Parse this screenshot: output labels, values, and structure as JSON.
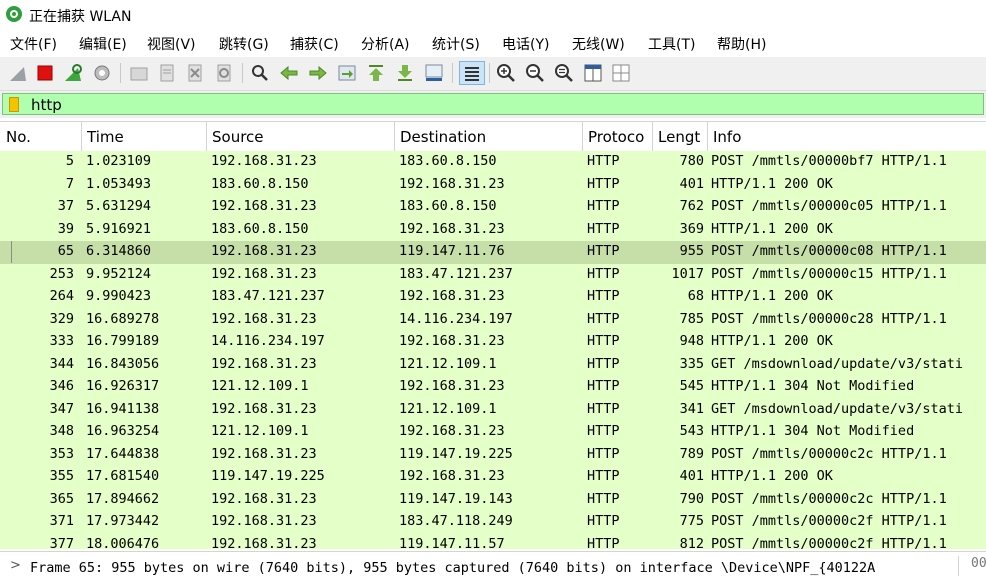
{
  "window": {
    "title": "正在捕获 WLAN"
  },
  "menu": [
    "文件(F)",
    "编辑(E)",
    "视图(V)",
    "跳转(G)",
    "捕获(C)",
    "分析(A)",
    "统计(S)",
    "电话(Y)",
    "无线(W)",
    "工具(T)",
    "帮助(H)"
  ],
  "toolbar": {
    "icons": [
      "shark-fin-start-icon",
      "stop-capture-icon",
      "restart-capture-icon",
      "capture-options-icon",
      "open-file-icon",
      "save-file-icon",
      "close-file-icon",
      "reload-file-icon",
      "find-packet-icon",
      "go-back-icon",
      "go-forward-icon",
      "go-to-packet-icon",
      "go-first-icon",
      "go-last-icon",
      "auto-scroll-icon",
      "colorize-icon",
      "zoom-in-icon",
      "zoom-out-icon",
      "normal-size-icon",
      "resize-columns-icon",
      "layout-icon"
    ]
  },
  "filter": {
    "value": "http"
  },
  "columns": [
    "No.",
    "Time",
    "Source",
    "Destination",
    "Protoco",
    "Lengt",
    "Info"
  ],
  "rows": [
    {
      "no": "5",
      "time": "1.023109",
      "src": "192.168.31.23",
      "dst": "183.60.8.150",
      "proto": "HTTP",
      "len": "780",
      "info": "POST /mmtls/00000bf7 HTTP/1.1"
    },
    {
      "no": "7",
      "time": "1.053493",
      "src": "183.60.8.150",
      "dst": "192.168.31.23",
      "proto": "HTTP",
      "len": "401",
      "info": "HTTP/1.1 200 OK"
    },
    {
      "no": "37",
      "time": "5.631294",
      "src": "192.168.31.23",
      "dst": "183.60.8.150",
      "proto": "HTTP",
      "len": "762",
      "info": "POST /mmtls/00000c05 HTTP/1.1"
    },
    {
      "no": "39",
      "time": "5.916921",
      "src": "183.60.8.150",
      "dst": "192.168.31.23",
      "proto": "HTTP",
      "len": "369",
      "info": "HTTP/1.1 200 OK"
    },
    {
      "no": "65",
      "time": "6.314860",
      "src": "192.168.31.23",
      "dst": "119.147.11.76",
      "proto": "HTTP",
      "len": "955",
      "info": "POST /mmtls/00000c08 HTTP/1.1"
    },
    {
      "no": "253",
      "time": "9.952124",
      "src": "192.168.31.23",
      "dst": "183.47.121.237",
      "proto": "HTTP",
      "len": "1017",
      "info": "POST /mmtls/00000c15 HTTP/1.1"
    },
    {
      "no": "264",
      "time": "9.990423",
      "src": "183.47.121.237",
      "dst": "192.168.31.23",
      "proto": "HTTP",
      "len": "68",
      "info": "HTTP/1.1 200 OK"
    },
    {
      "no": "329",
      "time": "16.689278",
      "src": "192.168.31.23",
      "dst": "14.116.234.197",
      "proto": "HTTP",
      "len": "785",
      "info": "POST /mmtls/00000c28 HTTP/1.1"
    },
    {
      "no": "333",
      "time": "16.799189",
      "src": "14.116.234.197",
      "dst": "192.168.31.23",
      "proto": "HTTP",
      "len": "948",
      "info": "HTTP/1.1 200 OK"
    },
    {
      "no": "344",
      "time": "16.843056",
      "src": "192.168.31.23",
      "dst": "121.12.109.1",
      "proto": "HTTP",
      "len": "335",
      "info": "GET /msdownload/update/v3/stati"
    },
    {
      "no": "346",
      "time": "16.926317",
      "src": "121.12.109.1",
      "dst": "192.168.31.23",
      "proto": "HTTP",
      "len": "545",
      "info": "HTTP/1.1 304 Not Modified"
    },
    {
      "no": "347",
      "time": "16.941138",
      "src": "192.168.31.23",
      "dst": "121.12.109.1",
      "proto": "HTTP",
      "len": "341",
      "info": "GET /msdownload/update/v3/stati"
    },
    {
      "no": "348",
      "time": "16.963254",
      "src": "121.12.109.1",
      "dst": "192.168.31.23",
      "proto": "HTTP",
      "len": "543",
      "info": "HTTP/1.1 304 Not Modified"
    },
    {
      "no": "353",
      "time": "17.644838",
      "src": "192.168.31.23",
      "dst": "119.147.19.225",
      "proto": "HTTP",
      "len": "789",
      "info": "POST /mmtls/00000c2c HTTP/1.1"
    },
    {
      "no": "355",
      "time": "17.681540",
      "src": "119.147.19.225",
      "dst": "192.168.31.23",
      "proto": "HTTP",
      "len": "401",
      "info": "HTTP/1.1 200 OK"
    },
    {
      "no": "365",
      "time": "17.894662",
      "src": "192.168.31.23",
      "dst": "119.147.19.143",
      "proto": "HTTP",
      "len": "790",
      "info": "POST /mmtls/00000c2c HTTP/1.1"
    },
    {
      "no": "371",
      "time": "17.973442",
      "src": "192.168.31.23",
      "dst": "183.47.118.249",
      "proto": "HTTP",
      "len": "775",
      "info": "POST /mmtls/00000c2f HTTP/1.1"
    },
    {
      "no": "377",
      "time": "18.006476",
      "src": "192.168.31.23",
      "dst": "119.147.11.57",
      "proto": "HTTP",
      "len": "812",
      "info": "POST /mmtls/00000c2f HTTP/1.1"
    }
  ],
  "selected_row": "65",
  "status": {
    "chevron": ">",
    "detail": "Frame 65: 955 bytes on wire (7640 bits), 955 bytes captured (7640 bits) on interface \\Device\\NPF_{40122A",
    "hex_preview": "00"
  },
  "colors": {
    "http_row": "#e4ffc7",
    "selected_row": "#c6dfa8",
    "filter_ok": "#afffaf"
  }
}
